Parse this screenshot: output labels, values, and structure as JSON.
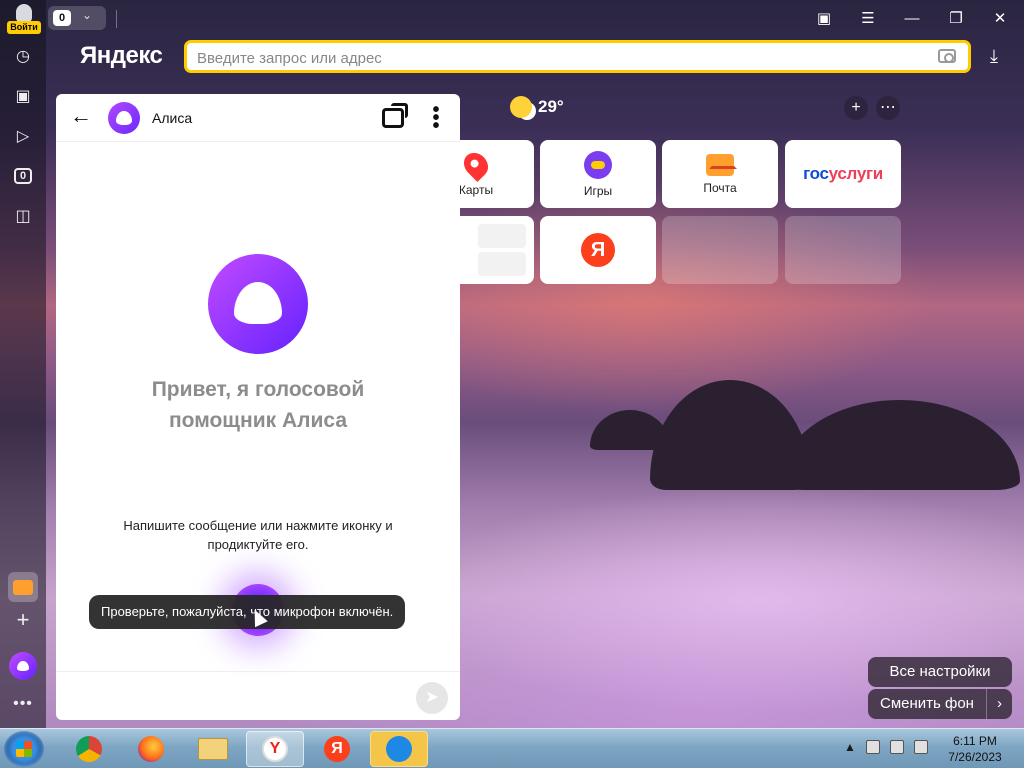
{
  "browser": {
    "login_label": "Войти",
    "tab_count": "0",
    "sidebar_counter": "0",
    "logo": "Яндекс",
    "search_placeholder": "Введите запрос или адрес"
  },
  "newtab": {
    "weather": {
      "icon": "sun-cloud-icon",
      "temperature": "29°"
    },
    "tiles": [
      {
        "label": "Карты",
        "icon": "maps-pin-icon"
      },
      {
        "label": "Игры",
        "icon": "games-icon"
      },
      {
        "label": "Почта",
        "icon": "mail-icon"
      },
      {
        "label": "госуслуги",
        "label_a": "гос",
        "label_b": "услуги",
        "icon": "gosuslugi-logo"
      },
      {
        "label": "",
        "icon": "yandex-logo-icon",
        "glyph": "Я"
      }
    ],
    "all_settings_label": "Все настройки",
    "change_bg_label": "Сменить фон"
  },
  "alice": {
    "title": "Алиса",
    "greeting": "Привет, я голосовой помощник Алиса",
    "hint": "Напишите сообщение или нажмите иконку и продиктуйте его.",
    "toast": "Проверьте, пожалуйста, что микрофон включён."
  },
  "taskbar": {
    "apps": [
      "chrome-icon",
      "firefox-icon",
      "file-explorer-icon",
      "yandex-browser-icon",
      "yandex-icon",
      "alice-app-icon"
    ],
    "time": "6:11 PM",
    "date": "7/26/2023"
  },
  "colors": {
    "accent_yellow": "#ffcc00",
    "alice_purple": "#7a2cff",
    "yandex_red": "#fc3f1d"
  }
}
